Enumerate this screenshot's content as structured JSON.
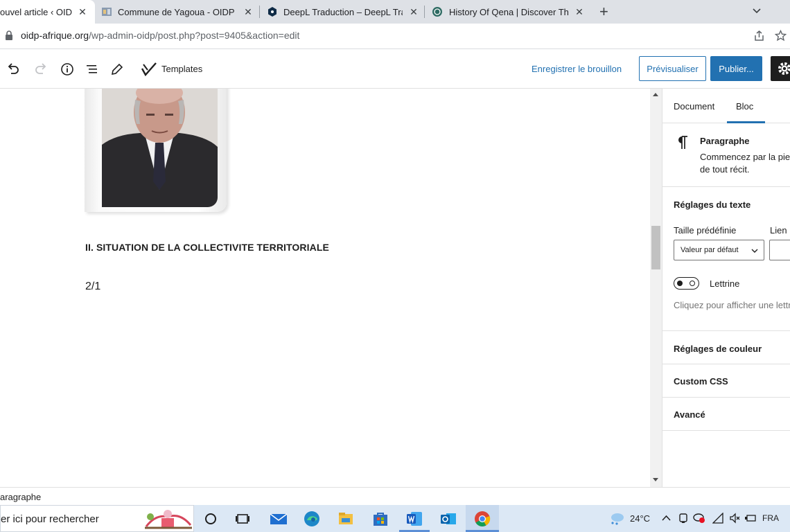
{
  "browser": {
    "tabs": [
      {
        "title": "ouvel article ‹ OIDP —",
        "active": true
      },
      {
        "title": "Commune de Yagoua - OIDP",
        "active": false
      },
      {
        "title": "DeepL Traduction – DeepL Transl",
        "active": false
      },
      {
        "title": "History Of Qena | Discover The H",
        "active": false
      }
    ],
    "close_glyph": "✕",
    "new_tab_glyph": "+",
    "url": {
      "host": "oidp-afrique.org",
      "path": "/wp-admin-oidp/post.php?post=9405&action=edit"
    }
  },
  "toolbar": {
    "templates_label": "Templates",
    "save_draft_label": "Enregistrer le brouillon",
    "preview_label": "Prévisualiser",
    "publish_label": "Publier..."
  },
  "editor": {
    "heading": "II. SITUATION DE LA COLLECTIVITE TERRITORIALE",
    "paragraph": "2/1"
  },
  "sidebar": {
    "tabs": {
      "document": "Document",
      "bloc": "Bloc"
    },
    "active_tab": "Bloc",
    "block": {
      "title": "Paragraphe",
      "description_line1": "Commencez par la pier",
      "description_line2": "de tout récit."
    },
    "text_settings": {
      "title": "Réglages du texte",
      "preset_size_label": "Taille prédéfinie",
      "preset_size_value": "Valeur par défaut",
      "link_label": "Lien",
      "dropcap_label": "Lettrine",
      "dropcap_enabled": false,
      "dropcap_help": "Cliquez pour afficher une lettr"
    },
    "panels": [
      "Réglages de couleur",
      "Custom CSS",
      "Avancé"
    ]
  },
  "statusbar": {
    "breadcrumb": "aragraphe"
  },
  "taskbar": {
    "search_placeholder": "er ici pour rechercher",
    "weather": "24°C",
    "language": "FRA",
    "accent_color": "#2271b1"
  }
}
